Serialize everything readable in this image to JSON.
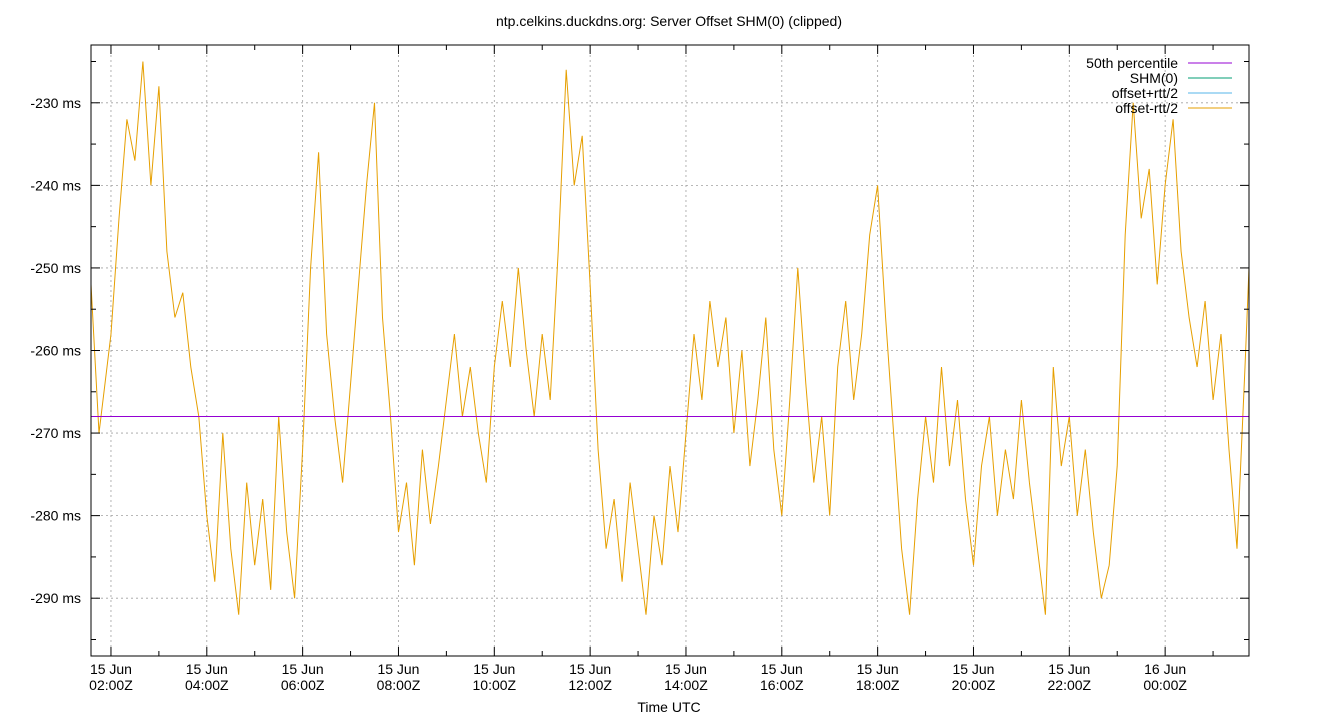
{
  "chart_data": {
    "type": "line",
    "title": "ntp.celkins.duckdns.org: Server Offset SHM(0) (clipped)",
    "xlabel": "Time UTC",
    "ylabel": "",
    "x_range": [
      "2024-06-15T01:35:00Z",
      "2024-06-16T01:45:00Z"
    ],
    "ylim": [
      -297,
      -223
    ],
    "y_unit": "ms",
    "grid": true,
    "legend_position": "top-right",
    "x_ticks": [
      {
        "time": "2024-06-15T02:00:00Z",
        "line1": "15 Jun",
        "line2": "02:00Z"
      },
      {
        "time": "2024-06-15T04:00:00Z",
        "line1": "15 Jun",
        "line2": "04:00Z"
      },
      {
        "time": "2024-06-15T06:00:00Z",
        "line1": "15 Jun",
        "line2": "06:00Z"
      },
      {
        "time": "2024-06-15T08:00:00Z",
        "line1": "15 Jun",
        "line2": "08:00Z"
      },
      {
        "time": "2024-06-15T10:00:00Z",
        "line1": "15 Jun",
        "line2": "10:00Z"
      },
      {
        "time": "2024-06-15T12:00:00Z",
        "line1": "15 Jun",
        "line2": "12:00Z"
      },
      {
        "time": "2024-06-15T14:00:00Z",
        "line1": "15 Jun",
        "line2": "14:00Z"
      },
      {
        "time": "2024-06-15T16:00:00Z",
        "line1": "15 Jun",
        "line2": "16:00Z"
      },
      {
        "time": "2024-06-15T18:00:00Z",
        "line1": "15 Jun",
        "line2": "18:00Z"
      },
      {
        "time": "2024-06-15T20:00:00Z",
        "line1": "15 Jun",
        "line2": "20:00Z"
      },
      {
        "time": "2024-06-15T22:00:00Z",
        "line1": "15 Jun",
        "line2": "22:00Z"
      },
      {
        "time": "2024-06-16T00:00:00Z",
        "line1": "16 Jun",
        "line2": "00:00Z"
      }
    ],
    "y_ticks": [
      {
        "value": -230,
        "label": "-230 ms"
      },
      {
        "value": -240,
        "label": "-240 ms"
      },
      {
        "value": -250,
        "label": "-250 ms"
      },
      {
        "value": -260,
        "label": "-260 ms"
      },
      {
        "value": -270,
        "label": "-270 ms"
      },
      {
        "value": -280,
        "label": "-280 ms"
      },
      {
        "value": -290,
        "label": "-290 ms"
      }
    ],
    "series": [
      {
        "name": "50th percentile",
        "color": "#9400d3",
        "kind": "hline",
        "value": -268
      },
      {
        "name": "SHM(0)",
        "color": "#009e73",
        "kind": "hidden"
      },
      {
        "name": "offset+rtt/2",
        "color": "#56b4e9",
        "kind": "hidden"
      },
      {
        "name": "offset-rtt/2",
        "color": "#e69f00",
        "kind": "line",
        "points": [
          [
            "2024-06-15T01:35:00Z",
            -252
          ],
          [
            "2024-06-15T01:45:00Z",
            -270
          ],
          [
            "2024-06-15T02:00:00Z",
            -258
          ],
          [
            "2024-06-15T02:10:00Z",
            -244
          ],
          [
            "2024-06-15T02:20:00Z",
            -232
          ],
          [
            "2024-06-15T02:30:00Z",
            -237
          ],
          [
            "2024-06-15T02:40:00Z",
            -225
          ],
          [
            "2024-06-15T02:50:00Z",
            -240
          ],
          [
            "2024-06-15T03:00:00Z",
            -228
          ],
          [
            "2024-06-15T03:10:00Z",
            -248
          ],
          [
            "2024-06-15T03:20:00Z",
            -256
          ],
          [
            "2024-06-15T03:30:00Z",
            -253
          ],
          [
            "2024-06-15T03:40:00Z",
            -262
          ],
          [
            "2024-06-15T03:50:00Z",
            -268
          ],
          [
            "2024-06-15T04:00:00Z",
            -280
          ],
          [
            "2024-06-15T04:10:00Z",
            -288
          ],
          [
            "2024-06-15T04:20:00Z",
            -270
          ],
          [
            "2024-06-15T04:30:00Z",
            -284
          ],
          [
            "2024-06-15T04:40:00Z",
            -292
          ],
          [
            "2024-06-15T04:50:00Z",
            -276
          ],
          [
            "2024-06-15T05:00:00Z",
            -286
          ],
          [
            "2024-06-15T05:10:00Z",
            -278
          ],
          [
            "2024-06-15T05:20:00Z",
            -289
          ],
          [
            "2024-06-15T05:30:00Z",
            -268
          ],
          [
            "2024-06-15T05:40:00Z",
            -282
          ],
          [
            "2024-06-15T05:50:00Z",
            -290
          ],
          [
            "2024-06-15T06:00:00Z",
            -272
          ],
          [
            "2024-06-15T06:10:00Z",
            -250
          ],
          [
            "2024-06-15T06:20:00Z",
            -236
          ],
          [
            "2024-06-15T06:30:00Z",
            -258
          ],
          [
            "2024-06-15T06:40:00Z",
            -268
          ],
          [
            "2024-06-15T06:50:00Z",
            -276
          ],
          [
            "2024-06-15T07:00:00Z",
            -264
          ],
          [
            "2024-06-15T07:10:00Z",
            -252
          ],
          [
            "2024-06-15T07:20:00Z",
            -240
          ],
          [
            "2024-06-15T07:30:00Z",
            -230
          ],
          [
            "2024-06-15T07:40:00Z",
            -256
          ],
          [
            "2024-06-15T07:50:00Z",
            -268
          ],
          [
            "2024-06-15T08:00:00Z",
            -282
          ],
          [
            "2024-06-15T08:10:00Z",
            -276
          ],
          [
            "2024-06-15T08:20:00Z",
            -286
          ],
          [
            "2024-06-15T08:30:00Z",
            -272
          ],
          [
            "2024-06-15T08:40:00Z",
            -281
          ],
          [
            "2024-06-15T08:50:00Z",
            -274
          ],
          [
            "2024-06-15T09:00:00Z",
            -266
          ],
          [
            "2024-06-15T09:10:00Z",
            -258
          ],
          [
            "2024-06-15T09:20:00Z",
            -268
          ],
          [
            "2024-06-15T09:30:00Z",
            -262
          ],
          [
            "2024-06-15T09:40:00Z",
            -270
          ],
          [
            "2024-06-15T09:50:00Z",
            -276
          ],
          [
            "2024-06-15T10:00:00Z",
            -262
          ],
          [
            "2024-06-15T10:10:00Z",
            -254
          ],
          [
            "2024-06-15T10:20:00Z",
            -262
          ],
          [
            "2024-06-15T10:30:00Z",
            -250
          ],
          [
            "2024-06-15T10:40:00Z",
            -260
          ],
          [
            "2024-06-15T10:50:00Z",
            -268
          ],
          [
            "2024-06-15T11:00:00Z",
            -258
          ],
          [
            "2024-06-15T11:10:00Z",
            -266
          ],
          [
            "2024-06-15T11:20:00Z",
            -248
          ],
          [
            "2024-06-15T11:30:00Z",
            -226
          ],
          [
            "2024-06-15T11:40:00Z",
            -240
          ],
          [
            "2024-06-15T11:50:00Z",
            -234
          ],
          [
            "2024-06-15T12:00:00Z",
            -252
          ],
          [
            "2024-06-15T12:10:00Z",
            -272
          ],
          [
            "2024-06-15T12:20:00Z",
            -284
          ],
          [
            "2024-06-15T12:30:00Z",
            -278
          ],
          [
            "2024-06-15T12:40:00Z",
            -288
          ],
          [
            "2024-06-15T12:50:00Z",
            -276
          ],
          [
            "2024-06-15T13:00:00Z",
            -284
          ],
          [
            "2024-06-15T13:10:00Z",
            -292
          ],
          [
            "2024-06-15T13:20:00Z",
            -280
          ],
          [
            "2024-06-15T13:30:00Z",
            -286
          ],
          [
            "2024-06-15T13:40:00Z",
            -274
          ],
          [
            "2024-06-15T13:50:00Z",
            -282
          ],
          [
            "2024-06-15T14:00:00Z",
            -270
          ],
          [
            "2024-06-15T14:10:00Z",
            -258
          ],
          [
            "2024-06-15T14:20:00Z",
            -266
          ],
          [
            "2024-06-15T14:30:00Z",
            -254
          ],
          [
            "2024-06-15T14:40:00Z",
            -262
          ],
          [
            "2024-06-15T14:50:00Z",
            -256
          ],
          [
            "2024-06-15T15:00:00Z",
            -270
          ],
          [
            "2024-06-15T15:10:00Z",
            -260
          ],
          [
            "2024-06-15T15:20:00Z",
            -274
          ],
          [
            "2024-06-15T15:30:00Z",
            -266
          ],
          [
            "2024-06-15T15:40:00Z",
            -256
          ],
          [
            "2024-06-15T15:50:00Z",
            -272
          ],
          [
            "2024-06-15T16:00:00Z",
            -280
          ],
          [
            "2024-06-15T16:10:00Z",
            -266
          ],
          [
            "2024-06-15T16:20:00Z",
            -250
          ],
          [
            "2024-06-15T16:30:00Z",
            -264
          ],
          [
            "2024-06-15T16:40:00Z",
            -276
          ],
          [
            "2024-06-15T16:50:00Z",
            -268
          ],
          [
            "2024-06-15T17:00:00Z",
            -280
          ],
          [
            "2024-06-15T17:10:00Z",
            -262
          ],
          [
            "2024-06-15T17:20:00Z",
            -254
          ],
          [
            "2024-06-15T17:30:00Z",
            -266
          ],
          [
            "2024-06-15T17:40:00Z",
            -258
          ],
          [
            "2024-06-15T17:50:00Z",
            -246
          ],
          [
            "2024-06-15T18:00:00Z",
            -240
          ],
          [
            "2024-06-15T18:10:00Z",
            -256
          ],
          [
            "2024-06-15T18:20:00Z",
            -270
          ],
          [
            "2024-06-15T18:30:00Z",
            -284
          ],
          [
            "2024-06-15T18:40:00Z",
            -292
          ],
          [
            "2024-06-15T18:50:00Z",
            -278
          ],
          [
            "2024-06-15T19:00:00Z",
            -268
          ],
          [
            "2024-06-15T19:10:00Z",
            -276
          ],
          [
            "2024-06-15T19:20:00Z",
            -262
          ],
          [
            "2024-06-15T19:30:00Z",
            -274
          ],
          [
            "2024-06-15T19:40:00Z",
            -266
          ],
          [
            "2024-06-15T19:50:00Z",
            -278
          ],
          [
            "2024-06-15T20:00:00Z",
            -286
          ],
          [
            "2024-06-15T20:10:00Z",
            -274
          ],
          [
            "2024-06-15T20:20:00Z",
            -268
          ],
          [
            "2024-06-15T20:30:00Z",
            -280
          ],
          [
            "2024-06-15T20:40:00Z",
            -272
          ],
          [
            "2024-06-15T20:50:00Z",
            -278
          ],
          [
            "2024-06-15T21:00:00Z",
            -266
          ],
          [
            "2024-06-15T21:10:00Z",
            -276
          ],
          [
            "2024-06-15T21:20:00Z",
            -284
          ],
          [
            "2024-06-15T21:30:00Z",
            -292
          ],
          [
            "2024-06-15T21:40:00Z",
            -262
          ],
          [
            "2024-06-15T21:50:00Z",
            -274
          ],
          [
            "2024-06-15T22:00:00Z",
            -268
          ],
          [
            "2024-06-15T22:10:00Z",
            -280
          ],
          [
            "2024-06-15T22:20:00Z",
            -272
          ],
          [
            "2024-06-15T22:30:00Z",
            -282
          ],
          [
            "2024-06-15T22:40:00Z",
            -290
          ],
          [
            "2024-06-15T22:50:00Z",
            -286
          ],
          [
            "2024-06-15T23:00:00Z",
            -274
          ],
          [
            "2024-06-15T23:10:00Z",
            -246
          ],
          [
            "2024-06-15T23:20:00Z",
            -230
          ],
          [
            "2024-06-15T23:30:00Z",
            -244
          ],
          [
            "2024-06-15T23:40:00Z",
            -238
          ],
          [
            "2024-06-15T23:50:00Z",
            -252
          ],
          [
            "2024-06-16T00:00:00Z",
            -240
          ],
          [
            "2024-06-16T00:10:00Z",
            -232
          ],
          [
            "2024-06-16T00:20:00Z",
            -248
          ],
          [
            "2024-06-16T00:30:00Z",
            -256
          ],
          [
            "2024-06-16T00:40:00Z",
            -262
          ],
          [
            "2024-06-16T00:50:00Z",
            -254
          ],
          [
            "2024-06-16T01:00:00Z",
            -266
          ],
          [
            "2024-06-16T01:10:00Z",
            -258
          ],
          [
            "2024-06-16T01:20:00Z",
            -272
          ],
          [
            "2024-06-16T01:30:00Z",
            -284
          ],
          [
            "2024-06-16T01:40:00Z",
            -262
          ],
          [
            "2024-06-16T01:45:00Z",
            -250
          ]
        ]
      }
    ]
  }
}
